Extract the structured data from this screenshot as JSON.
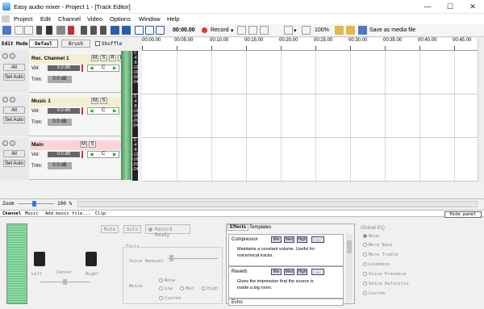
{
  "window": {
    "title": "Easy audio mixer - Project 1 - [Track Editor]",
    "minimize": "—",
    "maximize": "☐",
    "close": "✕"
  },
  "menu": [
    "Project",
    "Edit",
    "Channel",
    "Video",
    "Options",
    "Window",
    "Help"
  ],
  "toolbar": {
    "time": "00:00.00",
    "record": "Record",
    "zoom": "100%",
    "save_media": "Save as media file"
  },
  "editmode": {
    "label": "Edit Mode",
    "default": "Defaul",
    "brush": "Brush",
    "shuffle": "Shuffle"
  },
  "ruler": [
    "00:00.00",
    "00:05.00",
    "00:10.00",
    "00:15.00",
    "00:20.00",
    "00:25.00",
    "00:30.00",
    "00:35.00",
    "00:40.00",
    "00:45.00"
  ],
  "tracks": [
    {
      "name": "Rec. Channel 1",
      "vol": "0.0 dB",
      "pan": "C",
      "trim": "0.0 dB",
      "buttons": [
        "M",
        "S",
        "R",
        "L"
      ],
      "main": false
    },
    {
      "name": "Music 1",
      "vol": "0.0 dB",
      "pan": "C",
      "trim": "0.0 dB",
      "buttons": [
        "M",
        "S"
      ],
      "main": false
    },
    {
      "name": "Main",
      "vol": "0.0 dB",
      "pan": "C",
      "trim": "0.0 dB",
      "buttons": [
        "M",
        "S"
      ],
      "main": true
    }
  ],
  "side": {
    "all": "All",
    "set_auto": "Set Auto",
    "vol": "Vol:",
    "trim": "Trim:"
  },
  "dbscale": [
    "0",
    "-4",
    "-8",
    "-12",
    "-16",
    "-20",
    "-24",
    "-28",
    "-32"
  ],
  "zoombar": {
    "label": "Zoom",
    "value": "100 %"
  },
  "bottom_tabs": [
    "Channel",
    "Music",
    "Add music file...",
    "Clip"
  ],
  "hide_panel": "Hide panel",
  "channel": {
    "mute": "Mute",
    "solo": "Solo",
    "record_ready": "Record Ready",
    "left": "Left",
    "center": "Center",
    "right": "Right",
    "tools": "Tools",
    "voice_removal": "Voice Removal",
    "noise": "Noise",
    "noise_opts": [
      "None",
      "Low",
      "Med",
      "High",
      "Custom"
    ]
  },
  "effects": {
    "tabs": [
      "Effects",
      "Templates"
    ],
    "levels": [
      "Min",
      "Med",
      "High",
      "..."
    ],
    "items": [
      {
        "name": "Compressor",
        "desc": "Maintains a constant volume. Useful for voice/vocal tracks."
      },
      {
        "name": "Reverb",
        "desc": "Gives the impression that the source is inside a big room."
      },
      {
        "name": "Echo",
        "desc": ""
      }
    ]
  },
  "global_eq": {
    "title": "Global EQ",
    "options": [
      "None",
      "More Bass",
      "More Treble",
      "Loudness",
      "Voice Presence",
      "Voice Definitio",
      "Custom"
    ],
    "selected": "None"
  }
}
